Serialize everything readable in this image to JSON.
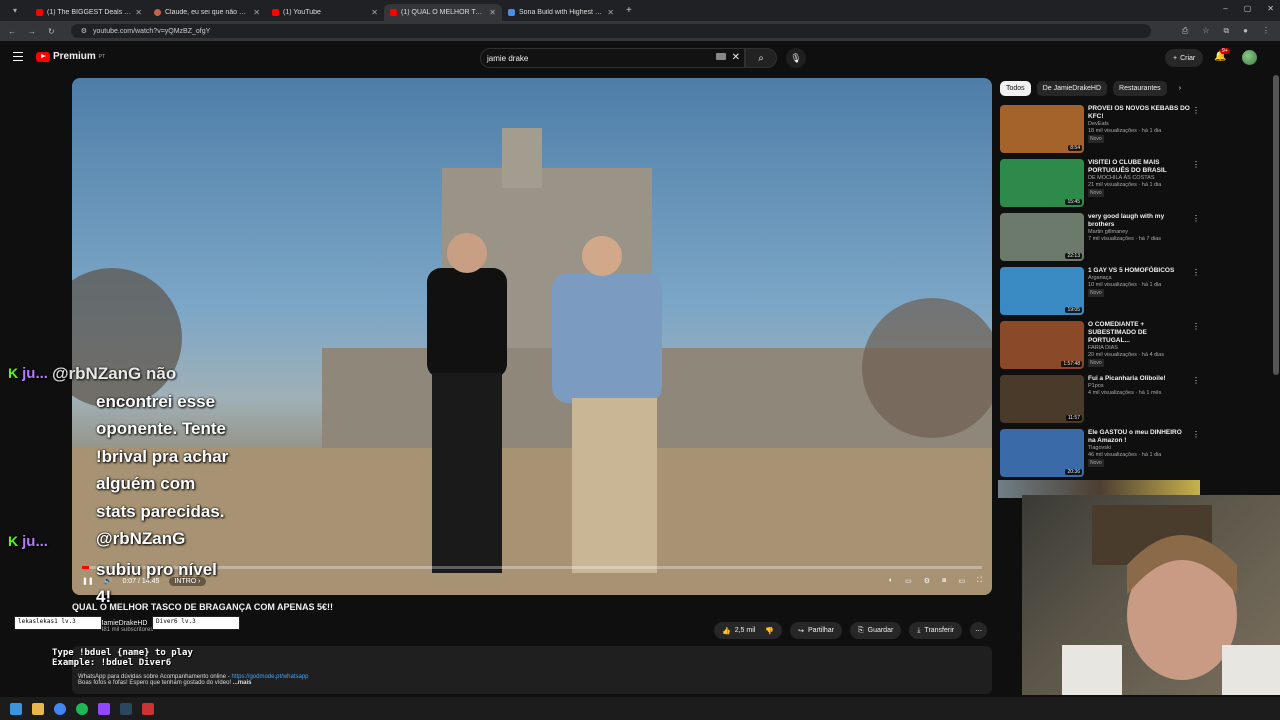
{
  "browser": {
    "tabs": [
      {
        "title": "(1) The BIGGEST Deals in Steam",
        "icon": "youtube-icon"
      },
      {
        "title": "Claude, eu sei que não és p",
        "icon": "claude-icon"
      },
      {
        "title": "(1) YouTube",
        "icon": "youtube-icon"
      },
      {
        "title": "(1) QUAL O MELHOR TASCO",
        "icon": "youtube-icon",
        "active": true
      },
      {
        "title": "Sona Build with Highest Winrat",
        "icon": "globe-icon"
      }
    ],
    "url": "youtube.com/watch?v=yQMzBZ_ofgY"
  },
  "header": {
    "logo_text": "Premium",
    "logo_region": "PT",
    "search_query": "jamie drake",
    "create_label": "Criar",
    "notif_count": "9+"
  },
  "player": {
    "time": "0:07 / 14:45",
    "chapter": "INTRO",
    "progress": 0.008
  },
  "chat": {
    "top_user": "ju...",
    "top_text_line": "@rbNZanG não",
    "lines": [
      "encontrei esse",
      "oponente. Tente",
      "!brival pra achar",
      "alguém com",
      "stats parecidas.",
      "@rbNZanG"
    ],
    "second_user": "ju...",
    "bottom_lines": [
      "subiu pro nível",
      "4!"
    ]
  },
  "overlay": {
    "box1": "lekaslekas1 lv.3",
    "box2": "Diver6 lv.3",
    "hint_line1": "Type !bduel {name} to play",
    "hint_line2": "Example: !bduel Diver6"
  },
  "video": {
    "title": "QUAL O MELHOR TASCO DE BRAGANÇA COM APENAS 5€!!",
    "channel": "JamieDrakeHD",
    "subs": "481 mil subscritores",
    "likes": "2,5 mil",
    "share": "Partilhar",
    "save": "Guardar",
    "download": "Transferir"
  },
  "description": {
    "line1": "WhatsApp para dúvidas sobre Acompanhamento online - ",
    "link": "https://godmode.pt/whatsapp",
    "line2": "Boas fofos e fofas! Espero que tenham gostado do vídeo!",
    "more": "...mais"
  },
  "chips": [
    "Todos",
    "De JamieDrakeHD",
    "Restaurantes"
  ],
  "recs": [
    {
      "title": "PROVEI OS NOVOS KEBABS DO KFC!",
      "channel": "DevEats",
      "meta": "18 mil visualizações · há 1 dia",
      "badge": "Novo",
      "dur": "8:54",
      "color": "#a3632a"
    },
    {
      "title": "VISITEI O CLUBE MAIS PORTUGUÊS DO BRASIL",
      "channel": "DE MOCHILA ÀS COSTAS",
      "meta": "21 mil visualizações · há 1 dia",
      "badge": "Novo",
      "dur": "15:45",
      "color": "#2d8a4a"
    },
    {
      "title": "very good laugh with my brothers",
      "channel": "Martin gillmaney",
      "meta": "7 mil visualizações · há 7 dias",
      "badge": "",
      "dur": "22:13",
      "color": "#6b7a6a"
    },
    {
      "title": "1 GAY VS 5 HOMOFÓBICOS",
      "channel": "Arganaça",
      "meta": "10 mil visualizações · há 1 dia",
      "badge": "Novo",
      "dur": "19:05",
      "color": "#3a8ac4"
    },
    {
      "title": "O COMEDIANTE + SUBESTIMADO DE PORTUGAL...",
      "channel": "FARIA DIAS",
      "meta": "20 mil visualizações · há 4 dias",
      "badge": "Novo",
      "dur": "1:57:48",
      "color": "#8a4a2a"
    },
    {
      "title": "Fui a Picanharia Oliboile!",
      "channel": "P1pos",
      "meta": "4 mil visualizações · há 1 mês",
      "badge": "",
      "dur": "11:57",
      "color": "#4a3a2a"
    },
    {
      "title": "Ele GASTOU o meu DINHEIRO na Amazon !",
      "channel": "Tiagovski",
      "meta": "46 mil visualizações · há 1 dia",
      "badge": "Novo",
      "dur": "20:36",
      "color": "#3a6aa8"
    }
  ]
}
